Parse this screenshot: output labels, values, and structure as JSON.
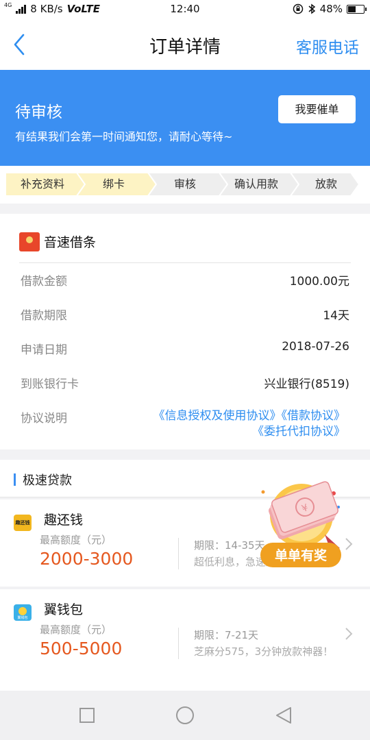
{
  "status_bar": {
    "network_label": "4G",
    "speed": "8 KB/s",
    "volte": "VoLTE",
    "time": "12:40",
    "battery_percent": "48%",
    "battery_level": 0.48
  },
  "header": {
    "title": "订单详情",
    "service_label": "客服电话"
  },
  "banner": {
    "status": "待审核",
    "message": "有结果我们会第一时间通知您，请耐心等待~",
    "urge_button": "我要催单"
  },
  "steps": [
    {
      "label": "补充资料",
      "done": true
    },
    {
      "label": "绑卡",
      "done": true
    },
    {
      "label": "审核",
      "done": false
    },
    {
      "label": "确认用款",
      "done": false
    },
    {
      "label": "放款",
      "done": false
    }
  ],
  "order": {
    "app_name": "音速借条",
    "rows": [
      {
        "label": "借款金额",
        "value": "1000.00元"
      },
      {
        "label": "借款期限",
        "value": "14天"
      },
      {
        "label": "申请日期",
        "value": "2018-07-26"
      },
      {
        "label": "到账银行卡",
        "value": "兴业银行(8519)"
      }
    ],
    "agreement_label": "协议说明",
    "agreement_line1": "《信息授权及使用协议》《借款协议》",
    "agreement_line2": "《委托代扣协议》"
  },
  "fast_loan": {
    "title": "极速贷款",
    "products": [
      {
        "name": "趣还钱",
        "logo_text": "趣还钱",
        "limit_label": "最高额度（元）",
        "limit": "2000-3000",
        "term": "期限：14-35天",
        "desc": "超低利息，急速放款"
      },
      {
        "name": "翼钱包",
        "logo_text": "翼钱包",
        "limit_label": "最高额度（元）",
        "limit": "500-5000",
        "term": "期限：7-21天",
        "desc": "芝麻分575，3分钟放款神器！"
      }
    ]
  },
  "promo": {
    "badge": "单单有奖"
  },
  "colors": {
    "primary": "#3b8ff2",
    "link": "#2f8ef0",
    "step_done": "#fdf3c4",
    "step_todo": "#eeeeee",
    "amount": "#e5581f",
    "promo_badge": "#f0a020"
  }
}
